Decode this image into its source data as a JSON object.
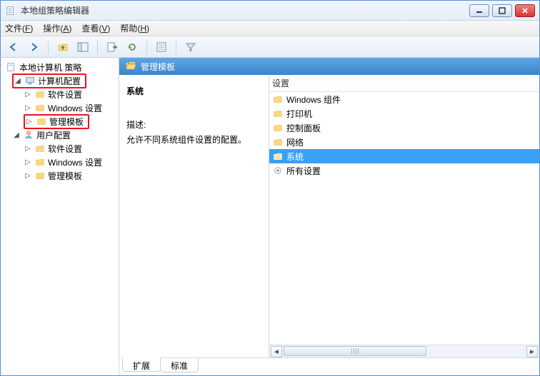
{
  "window": {
    "title": "本地组策略编辑器"
  },
  "menu": {
    "file": {
      "label": "文件",
      "accel": "F"
    },
    "action": {
      "label": "操作",
      "accel": "A"
    },
    "view": {
      "label": "查看",
      "accel": "V"
    },
    "help": {
      "label": "帮助",
      "accel": "H"
    }
  },
  "tree": {
    "root": "本地计算机 策略",
    "computer_config": "计算机配置",
    "comp_sw": "软件设置",
    "comp_win": "Windows 设置",
    "comp_tpl": "管理模板",
    "user_config": "用户配置",
    "user_sw": "软件设置",
    "user_win": "Windows 设置",
    "user_tpl": "管理模板"
  },
  "content": {
    "header": "管理模板",
    "desc_title": "系统",
    "desc_label": "描述:",
    "desc_body": "允许不同系统组件设置的配置。",
    "list_header": "设置",
    "items": {
      "0": "Windows 组件",
      "1": "打印机",
      "2": "控制面板",
      "3": "网络",
      "4": "系统",
      "5": "所有设置"
    }
  },
  "tabs": {
    "ext": "扩展",
    "std": "标准"
  }
}
